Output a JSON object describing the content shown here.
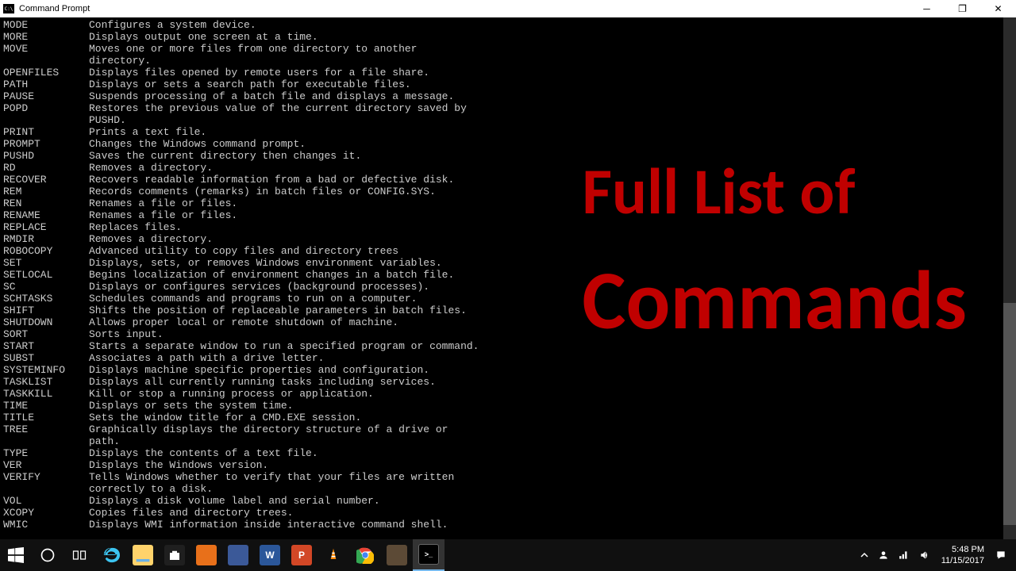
{
  "window": {
    "title": "Command Prompt"
  },
  "overlay": {
    "line1": "Full List of",
    "line2": "Commands"
  },
  "commands": [
    {
      "name": "MODE",
      "desc": "Configures a system device."
    },
    {
      "name": "MORE",
      "desc": "Displays output one screen at a time."
    },
    {
      "name": "MOVE",
      "desc": "Moves one or more files from one directory to another\ndirectory."
    },
    {
      "name": "OPENFILES",
      "desc": "Displays files opened by remote users for a file share."
    },
    {
      "name": "PATH",
      "desc": "Displays or sets a search path for executable files."
    },
    {
      "name": "PAUSE",
      "desc": "Suspends processing of a batch file and displays a message."
    },
    {
      "name": "POPD",
      "desc": "Restores the previous value of the current directory saved by\nPUSHD."
    },
    {
      "name": "PRINT",
      "desc": "Prints a text file."
    },
    {
      "name": "PROMPT",
      "desc": "Changes the Windows command prompt."
    },
    {
      "name": "PUSHD",
      "desc": "Saves the current directory then changes it."
    },
    {
      "name": "RD",
      "desc": "Removes a directory."
    },
    {
      "name": "RECOVER",
      "desc": "Recovers readable information from a bad or defective disk."
    },
    {
      "name": "REM",
      "desc": "Records comments (remarks) in batch files or CONFIG.SYS."
    },
    {
      "name": "REN",
      "desc": "Renames a file or files."
    },
    {
      "name": "RENAME",
      "desc": "Renames a file or files."
    },
    {
      "name": "REPLACE",
      "desc": "Replaces files."
    },
    {
      "name": "RMDIR",
      "desc": "Removes a directory."
    },
    {
      "name": "ROBOCOPY",
      "desc": "Advanced utility to copy files and directory trees"
    },
    {
      "name": "SET",
      "desc": "Displays, sets, or removes Windows environment variables."
    },
    {
      "name": "SETLOCAL",
      "desc": "Begins localization of environment changes in a batch file."
    },
    {
      "name": "SC",
      "desc": "Displays or configures services (background processes)."
    },
    {
      "name": "SCHTASKS",
      "desc": "Schedules commands and programs to run on a computer."
    },
    {
      "name": "SHIFT",
      "desc": "Shifts the position of replaceable parameters in batch files."
    },
    {
      "name": "SHUTDOWN",
      "desc": "Allows proper local or remote shutdown of machine."
    },
    {
      "name": "SORT",
      "desc": "Sorts input."
    },
    {
      "name": "START",
      "desc": "Starts a separate window to run a specified program or command."
    },
    {
      "name": "SUBST",
      "desc": "Associates a path with a drive letter."
    },
    {
      "name": "SYSTEMINFO",
      "desc": "Displays machine specific properties and configuration."
    },
    {
      "name": "TASKLIST",
      "desc": "Displays all currently running tasks including services."
    },
    {
      "name": "TASKKILL",
      "desc": "Kill or stop a running process or application."
    },
    {
      "name": "TIME",
      "desc": "Displays or sets the system time."
    },
    {
      "name": "TITLE",
      "desc": "Sets the window title for a CMD.EXE session."
    },
    {
      "name": "TREE",
      "desc": "Graphically displays the directory structure of a drive or\npath."
    },
    {
      "name": "TYPE",
      "desc": "Displays the contents of a text file."
    },
    {
      "name": "VER",
      "desc": "Displays the Windows version."
    },
    {
      "name": "VERIFY",
      "desc": "Tells Windows whether to verify that your files are written\ncorrectly to a disk."
    },
    {
      "name": "VOL",
      "desc": "Displays a disk volume label and serial number."
    },
    {
      "name": "XCOPY",
      "desc": "Copies files and directory trees."
    },
    {
      "name": "WMIC",
      "desc": "Displays WMI information inside interactive command shell."
    }
  ],
  "taskbar": {
    "apps": [
      {
        "name": "start",
        "color": "#fff"
      },
      {
        "name": "cortana-search",
        "color": "#fff"
      },
      {
        "name": "task-view",
        "color": "#fff"
      },
      {
        "name": "edge",
        "color": "#0078d7"
      },
      {
        "name": "file-explorer",
        "color": "#ffcf48"
      },
      {
        "name": "store",
        "color": "#fff"
      },
      {
        "name": "app-orange",
        "color": "#e8701a"
      },
      {
        "name": "app-editor",
        "color": "#3b5998"
      },
      {
        "name": "word",
        "color": "#2b579a",
        "label": "W"
      },
      {
        "name": "powerpoint",
        "color": "#d24726",
        "label": "P"
      },
      {
        "name": "vlc",
        "color": "#ff8800"
      },
      {
        "name": "chrome",
        "color": "#fff"
      },
      {
        "name": "gimp",
        "color": "#5c4a36"
      },
      {
        "name": "cmd",
        "color": "#222",
        "active": true
      }
    ],
    "tray": {
      "time": "5:48 PM",
      "date": "11/15/2017"
    }
  }
}
